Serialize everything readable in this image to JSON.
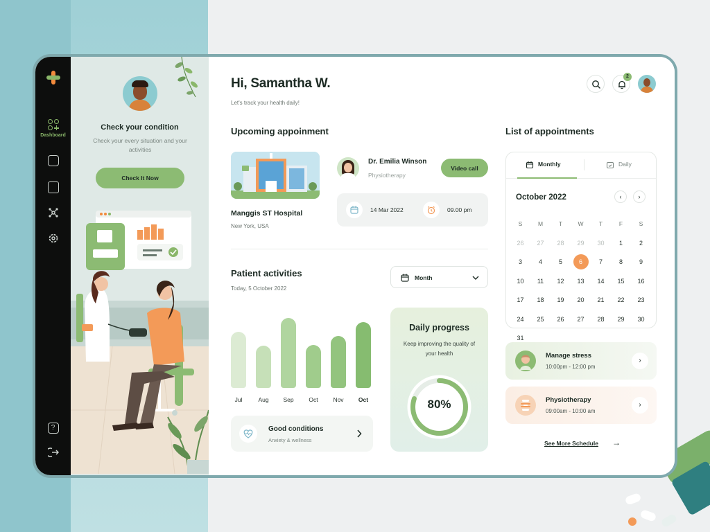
{
  "sidebar": {
    "items": [
      {
        "label": "Dashboard",
        "icon": "dashboard-icon",
        "active": true
      },
      {
        "icon": "calendar-icon"
      },
      {
        "icon": "clipboard-icon"
      },
      {
        "icon": "network-icon"
      },
      {
        "icon": "settings-icon"
      }
    ],
    "bottom": [
      {
        "icon": "help-icon"
      },
      {
        "icon": "logout-icon"
      }
    ]
  },
  "left_panel": {
    "title": "Check your condition",
    "subtitle": "Check your every situation and your activities",
    "button": "Check It Now"
  },
  "header": {
    "greeting": "Hi, Samantha W.",
    "subtitle": "Let's track your health daily!",
    "notification_count": "2"
  },
  "upcoming": {
    "title": "Upcoming appoinment",
    "hospital": "Manggis ST Hospital",
    "location": "New York, USA",
    "doctor": "Dr. Emilia Winson",
    "specialty": "Physiotherapy",
    "video_button": "Video call",
    "date": "14 Mar 2022",
    "time": "09.00 pm"
  },
  "activities": {
    "title": "Patient activities",
    "date": "Today, 5 October 2022",
    "period": "Month",
    "good_title": "Good conditions",
    "good_sub": "Anxiety & wellness"
  },
  "chart_data": {
    "type": "bar",
    "categories": [
      "Jul",
      "Aug",
      "Sep",
      "Oct",
      "Nov",
      "Oct"
    ],
    "values": [
      74,
      55,
      92,
      56,
      68,
      86
    ],
    "ylim": [
      0,
      100
    ],
    "colors": [
      "#dcebd3",
      "#c6e0b8",
      "#b0d59f",
      "#a0cc8c",
      "#93c47e",
      "#86bc70"
    ]
  },
  "progress": {
    "title": "Daily progress",
    "subtitle": "Keep improving the quality of your health",
    "value": "80%",
    "fraction": 0.8
  },
  "appointments": {
    "title": "List of appointments",
    "tab_monthly": "Monthly",
    "tab_daily": "Daily",
    "month": "October 2022",
    "weekdays": [
      "S",
      "M",
      "T",
      "W",
      "T",
      "F",
      "S"
    ],
    "days": [
      26,
      27,
      28,
      29,
      30,
      1,
      2,
      3,
      4,
      5,
      6,
      7,
      8,
      9,
      10,
      11,
      12,
      13,
      14,
      15,
      16,
      17,
      18,
      19,
      20,
      21,
      22,
      23,
      24,
      25,
      26,
      27,
      28,
      29,
      30,
      31
    ],
    "today": 6,
    "items": [
      {
        "title": "Manage stress",
        "time": "10:00pm - 12:00 pm"
      },
      {
        "title": "Physiotherapy",
        "time": "09:00am - 10:00 am"
      }
    ],
    "see_more": "See More Schedule"
  },
  "colors": {
    "accent": "#8cbb73",
    "orange": "#f39a58",
    "dark": "#0d0e0d"
  }
}
